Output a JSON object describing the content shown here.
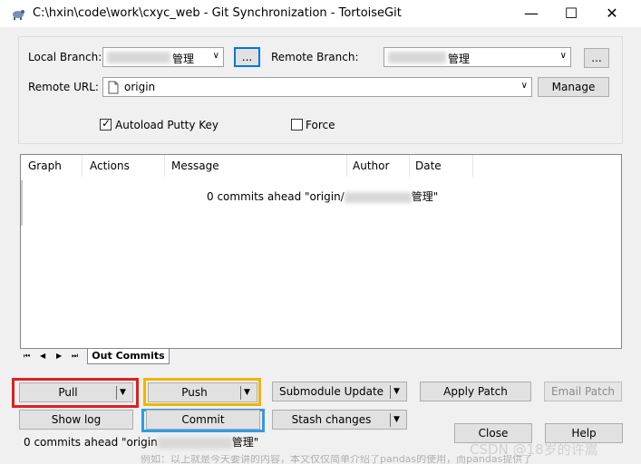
{
  "window": {
    "title": "C:\\hxin\\code\\work\\cxyc_web - Git Synchronization - TortoiseGit",
    "minimize_glyph": "—",
    "maximize_glyph": "☐",
    "close_glyph": "✕"
  },
  "branch": {
    "local_label": "Local Branch:",
    "local_value": "管理",
    "browse_label": "...",
    "remote_label": "Remote Branch:",
    "remote_value": "管理",
    "remote_browse_label": "..."
  },
  "remote_url": {
    "label": "Remote URL:",
    "value": "origin",
    "manage_label": "Manage"
  },
  "options": {
    "autoload_label": "Autoload Putty Key",
    "autoload_checked": "✓",
    "force_label": "Force"
  },
  "table": {
    "columns": [
      "Graph",
      "Actions",
      "Message",
      "Author",
      "Date"
    ],
    "message_prefix": "0 commits ahead \"origin/",
    "message_suffix": "管理\""
  },
  "tabs": {
    "nav": [
      "⏮",
      "◀",
      "▶",
      "⏭"
    ],
    "active": "Out Commits"
  },
  "buttons": {
    "pull": "Pull",
    "push": "Push",
    "submodule_update": "Submodule Update",
    "apply_patch": "Apply Patch",
    "email_patch": "Email Patch",
    "show_log": "Show log",
    "commit": "Commit",
    "stash_changes": "Stash changes",
    "close": "Close",
    "help": "Help",
    "dropdown_glyph": "▼"
  },
  "status": {
    "prefix": "0 commits ahead \"origin",
    "suffix": "管理\""
  },
  "watermark": "CSDN @18岁的许嵩",
  "underlay_text": "例如：以上就是今天要讲的内容，本文仅仅简单介绍了pandas的使用，而pandas提供了",
  "colors": {
    "pull_highlight": "#e02020",
    "push_highlight": "#f2b400",
    "commit_highlight": "#2f9be8",
    "focus_blue": "#0078d7"
  }
}
